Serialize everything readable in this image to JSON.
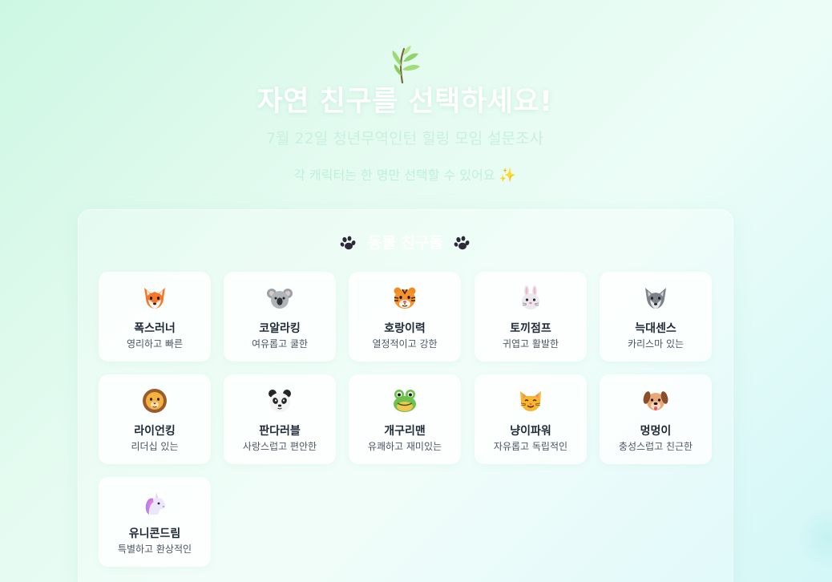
{
  "header": {
    "title": "자연 친구를 선택하세요!",
    "subtitle": "7월 22일 청년무역인턴 힐링 모임 설문조사",
    "notice": "각 캐릭터는 한 명만 선택할 수 있어요",
    "notice_icon": "✨"
  },
  "section": {
    "title": "동물 친구들"
  },
  "animals": [
    {
      "icon": "fox-icon",
      "name": "폭스러너",
      "desc": "영리하고 빠른"
    },
    {
      "icon": "koala-icon",
      "name": "코알라킹",
      "desc": "여유롭고 쿨한"
    },
    {
      "icon": "tiger-icon",
      "name": "호랑이력",
      "desc": "열정적이고 강한"
    },
    {
      "icon": "rabbit-icon",
      "name": "토끼점프",
      "desc": "귀엽고 활발한"
    },
    {
      "icon": "wolf-icon",
      "name": "늑대센스",
      "desc": "카리스마 있는"
    },
    {
      "icon": "lion-icon",
      "name": "라이언킹",
      "desc": "리더십 있는"
    },
    {
      "icon": "panda-icon",
      "name": "판다러블",
      "desc": "사랑스럽고 편안한"
    },
    {
      "icon": "frog-icon",
      "name": "개구리맨",
      "desc": "유쾌하고 재미있는"
    },
    {
      "icon": "cat-icon",
      "name": "냥이파워",
      "desc": "자유롭고 독립적인"
    },
    {
      "icon": "dog-icon",
      "name": "멍멍이",
      "desc": "충성스럽고 친근한"
    },
    {
      "icon": "unicorn-icon",
      "name": "유니콘드림",
      "desc": "특별하고 환상적인"
    }
  ]
}
